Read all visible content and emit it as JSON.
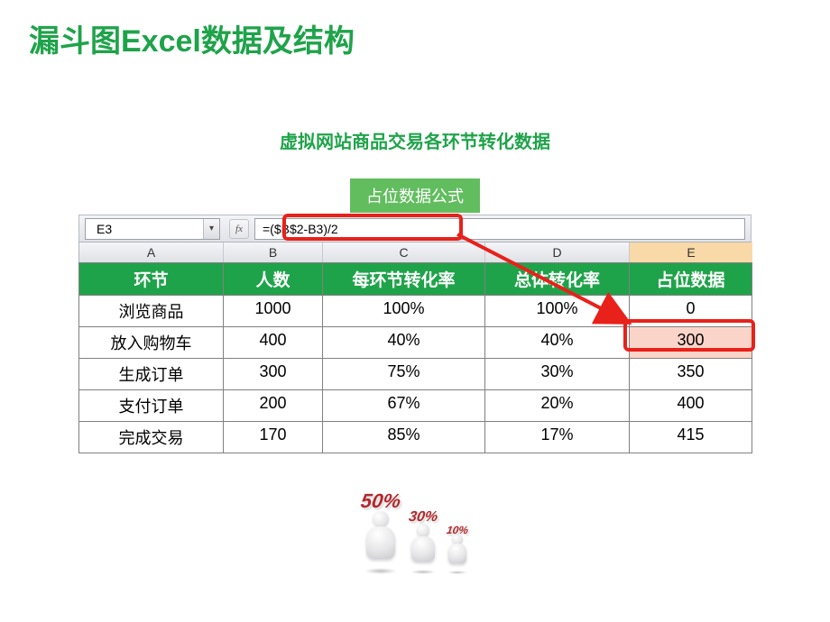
{
  "title": "漏斗图Excel数据及结构",
  "subtitle": "虚拟网站商品交易各环节转化数据",
  "formula_badge": "占位数据公式",
  "excel": {
    "name_box": "E3",
    "fx_label": "fx",
    "formula": "=($B$2-B3)/2",
    "col_letters": [
      "A",
      "B",
      "C",
      "D",
      "E"
    ],
    "selected_col_index": 4,
    "headers": [
      "环节",
      "人数",
      "每环节转化率",
      "总体转化率",
      "占位数据"
    ],
    "rows": [
      [
        "浏览商品",
        "1000",
        "100%",
        "100%",
        "0"
      ],
      [
        "放入购物车",
        "400",
        "40%",
        "40%",
        "300"
      ],
      [
        "生成订单",
        "300",
        "75%",
        "30%",
        "350"
      ],
      [
        "支付订单",
        "200",
        "67%",
        "20%",
        "400"
      ],
      [
        "完成交易",
        "170",
        "85%",
        "17%",
        "415"
      ]
    ],
    "highlighted_cell": {
      "row": 1,
      "col": 4
    }
  },
  "figures": [
    {
      "label": "50%",
      "size": "l"
    },
    {
      "label": "30%",
      "size": "m"
    },
    {
      "label": "10%",
      "size": "s"
    }
  ],
  "chart_data": {
    "type": "table",
    "title": "虚拟网站商品交易各环节转化数据",
    "columns": [
      "环节",
      "人数",
      "每环节转化率",
      "总体转化率",
      "占位数据"
    ],
    "rows": [
      {
        "环节": "浏览商品",
        "人数": 1000,
        "每环节转化率": 1.0,
        "总体转化率": 1.0,
        "占位数据": 0
      },
      {
        "环节": "放入购物车",
        "人数": 400,
        "每环节转化率": 0.4,
        "总体转化率": 0.4,
        "占位数据": 300
      },
      {
        "环节": "生成订单",
        "人数": 300,
        "每环节转化率": 0.75,
        "总体转化率": 0.3,
        "占位数据": 350
      },
      {
        "环节": "支付订单",
        "人数": 200,
        "每环节转化率": 0.67,
        "总体转化率": 0.2,
        "占位数据": 400
      },
      {
        "环节": "完成交易",
        "人数": 170,
        "每环节转化率": 0.85,
        "总体转化率": 0.17,
        "占位数据": 415
      }
    ],
    "formula_note": "占位数据 = ($B$2 - B_row)/2"
  }
}
